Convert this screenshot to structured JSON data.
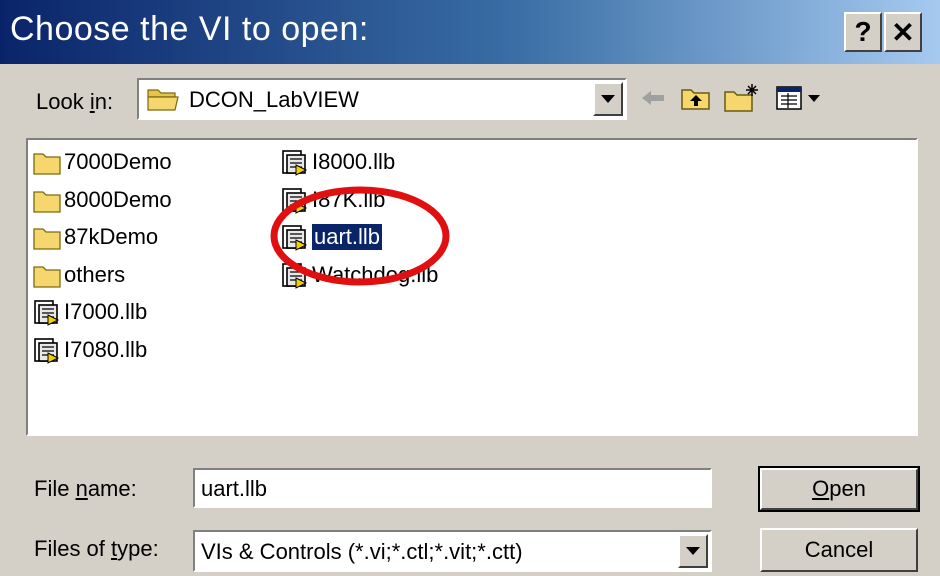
{
  "dialog": {
    "title": "Choose the VI to open:",
    "help_label": "?",
    "close_label": "✕"
  },
  "lookin": {
    "label_pre": "Look ",
    "label_access": "i",
    "label_post": "n:",
    "value": "DCON_LabVIEW"
  },
  "toolbar": {
    "back_icon": "back-arrow-icon",
    "up_icon": "up-one-level-icon",
    "new_folder_icon": "new-folder-icon",
    "view_icon": "view-menu-icon"
  },
  "files": {
    "column1": [
      "7000Demo",
      "8000Demo",
      "87kDemo",
      "others",
      "I7000.llb",
      "I7080.llb"
    ],
    "column2": [
      "I8000.llb",
      "I87K.llb",
      "uart.llb",
      "Watchdog.llb"
    ],
    "selected": "uart.llb"
  },
  "filename": {
    "label_pre": "File ",
    "label_access": "n",
    "label_post": "ame:",
    "value": "uart.llb"
  },
  "filetype": {
    "label_pre": "Files of ",
    "label_access": "t",
    "label_post": "ype:",
    "value": "VIs & Controls (*.vi;*.ctl;*.vit;*.ctt)"
  },
  "buttons": {
    "open_access": "O",
    "open_rest": "pen",
    "cancel": "Cancel"
  },
  "colors": {
    "annotation_circle": "#e01010",
    "selection": "#0a246a",
    "folder": "#f5d76e"
  }
}
